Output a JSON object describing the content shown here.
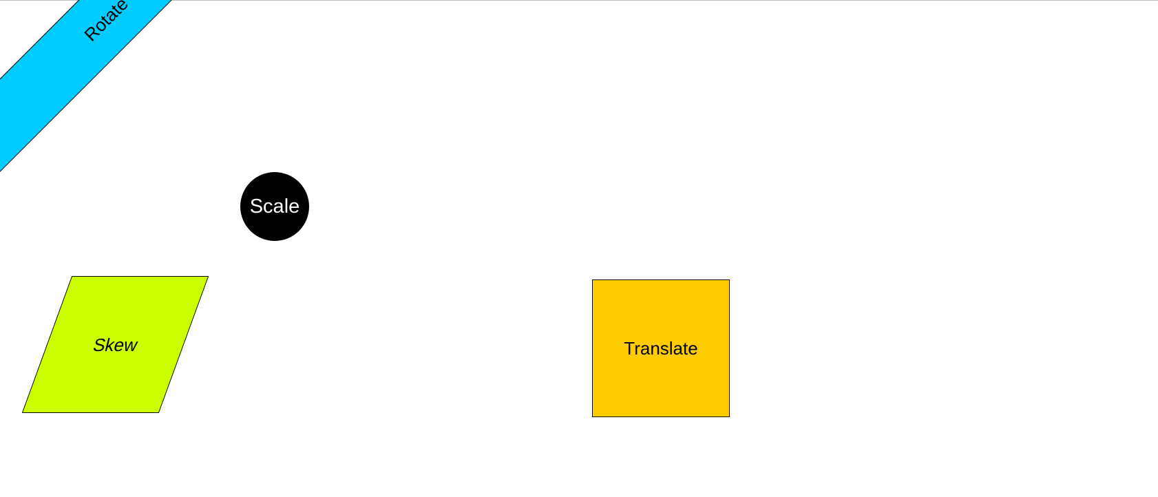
{
  "shapes": {
    "rotate": {
      "label": "Rotate",
      "color": "#00ccff"
    },
    "scale": {
      "label": "Scale",
      "color": "#000000",
      "text_color": "#ffffff"
    },
    "skew": {
      "label": "Skew",
      "color": "#ccff00"
    },
    "translate": {
      "label": "Translate",
      "color": "#ffcc00"
    }
  }
}
